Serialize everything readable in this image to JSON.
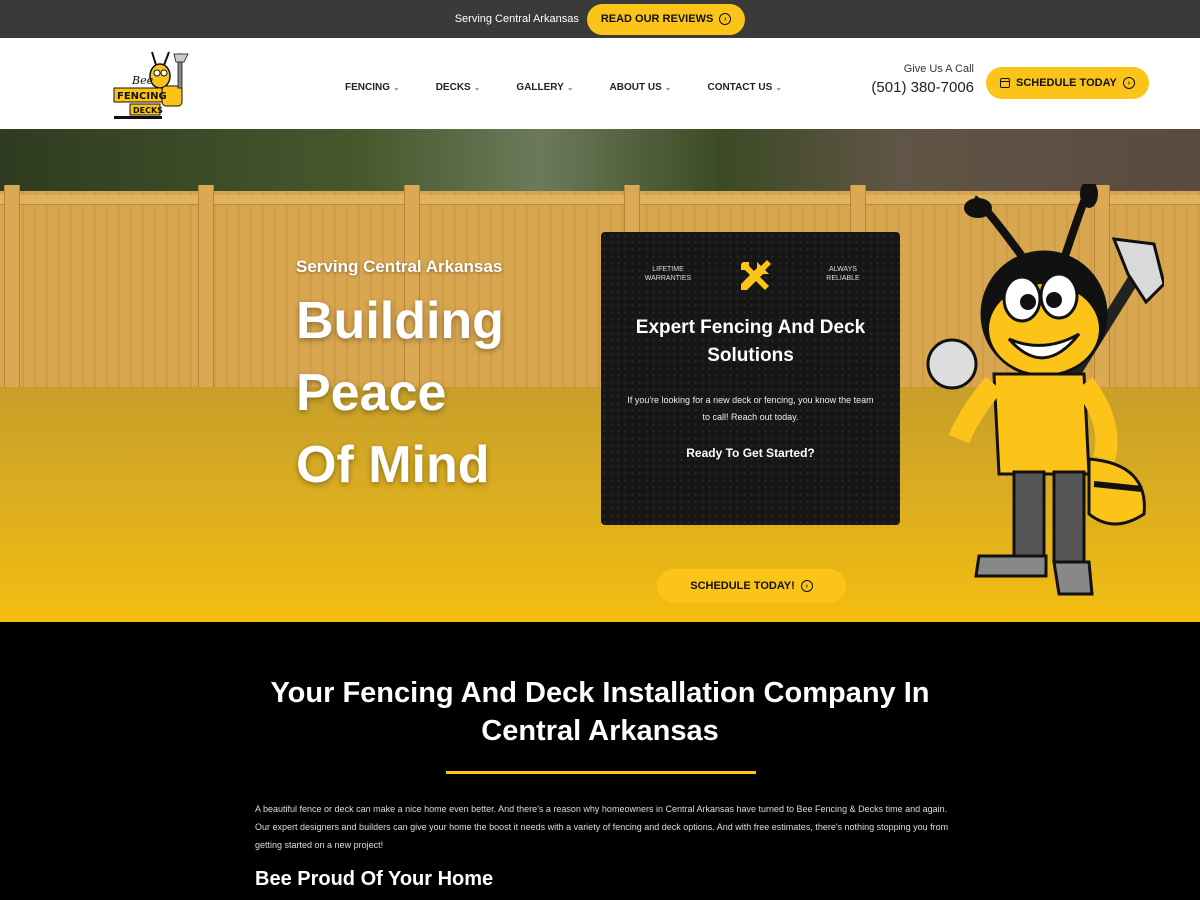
{
  "topbar": {
    "text": "Serving Central Arkansas",
    "button_label": "READ OUR REVIEWS"
  },
  "header": {
    "logo_alt": "Bee Fencing and Decks",
    "nav": [
      {
        "label": "FENCING"
      },
      {
        "label": "DECKS"
      },
      {
        "label": "GALLERY"
      },
      {
        "label": "ABOUT US"
      },
      {
        "label": "CONTACT US"
      }
    ],
    "call_label": "Give Us A Call",
    "phone": "(501) 380-7006",
    "schedule_label": "SCHEDULE TODAY"
  },
  "hero": {
    "subtitle": "Serving Central Arkansas",
    "title_line1": "Building",
    "title_line2": "Peace",
    "title_line3": "Of Mind",
    "card": {
      "left_badge_line1": "LIFETIME",
      "left_badge_line2": "WARRANTIES",
      "right_badge_line1": "ALWAYS",
      "right_badge_line2": "RELIABLE",
      "title": "Expert Fencing And Deck Solutions",
      "text": "If you're looking for a new deck or fencing, you know the team to call! Reach out today.",
      "question": "Ready To Get Started?",
      "button_label": "SCHEDULE TODAY!"
    }
  },
  "section": {
    "title": "Your Fencing And Deck Installation Company In Central Arkansas",
    "body": "A beautiful fence or deck can make a nice home even better. And there's a reason why homeowners in Central Arkansas have turned to Bee Fencing & Decks time and again. Our expert designers and builders can give your home the boost it needs with a variety of fencing and deck options. And with free estimates, there's nothing stopping you from getting started on a new project!",
    "subheading": "Bee Proud Of Your Home"
  },
  "colors": {
    "accent": "#fcc419",
    "topbar": "#3a3a3a",
    "dark": "#000000"
  }
}
